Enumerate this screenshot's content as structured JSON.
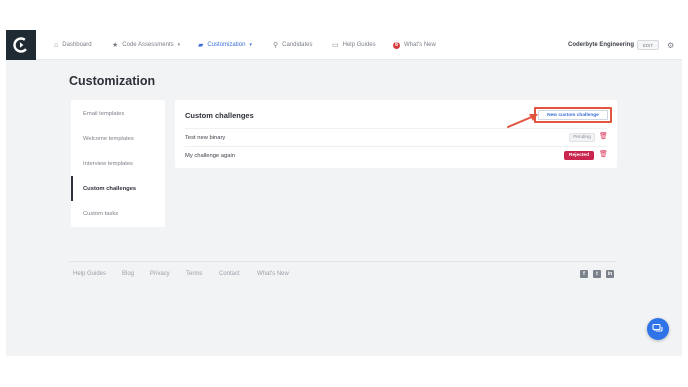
{
  "nav": {
    "items": [
      {
        "label": "Dashboard",
        "icon": "home-icon"
      },
      {
        "label": "Code Assessments",
        "icon": "star-icon"
      },
      {
        "label": "Customization",
        "icon": "chat-icon"
      },
      {
        "label": "Candidates",
        "icon": "search-icon"
      },
      {
        "label": "Help Guides",
        "icon": "book-icon"
      },
      {
        "label": "What's New",
        "icon": "notification-badge",
        "badge": "8"
      }
    ],
    "org_name": "Coderbyte Engineering",
    "org_badge": "EDIT"
  },
  "page_title": "Customization",
  "sidebar": {
    "items": [
      {
        "label": "Email templates"
      },
      {
        "label": "Welcome templates"
      },
      {
        "label": "Interview templates"
      },
      {
        "label": "Custom challenges"
      },
      {
        "label": "Custom tasks"
      }
    ]
  },
  "card": {
    "title": "Custom challenges",
    "new_button_label": "New custom challenge",
    "rows": [
      {
        "name": "Test new binary",
        "status": "Pending"
      },
      {
        "name": "My challenge again",
        "status": "Rejected"
      }
    ]
  },
  "footer": {
    "links": [
      "Help Guides",
      "Blog",
      "Privacy",
      "Terms",
      "Contact",
      "What's New"
    ],
    "social": [
      "facebook-icon",
      "twitter-icon",
      "linkedin-icon"
    ]
  },
  "colors": {
    "accent": "#3b6fd8",
    "annotation": "#e2553f",
    "rejected": "#c9254e",
    "chat_button": "#2f73e8"
  }
}
